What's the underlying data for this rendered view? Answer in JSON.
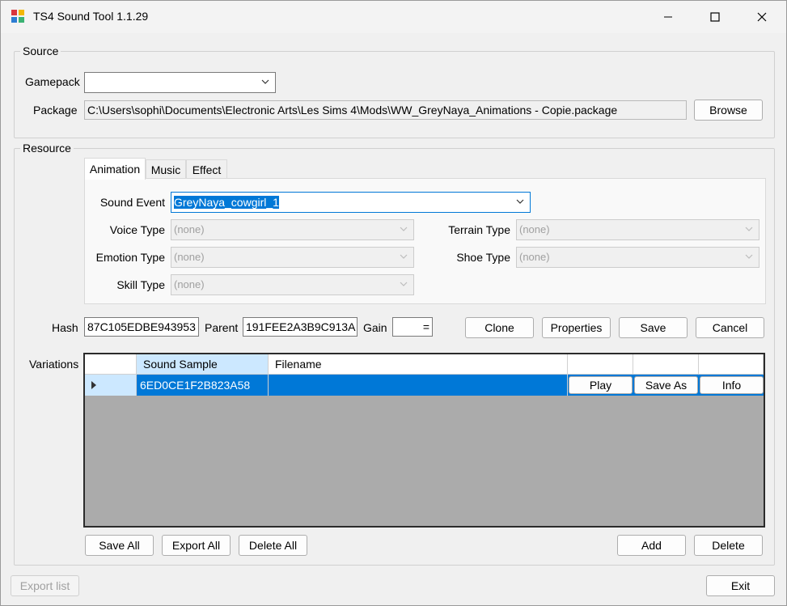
{
  "window": {
    "title": "TS4 Sound Tool 1.1.29",
    "minimize_icon": "minimize-icon",
    "maximize_icon": "maximize-icon",
    "close_icon": "close-icon"
  },
  "source": {
    "group_label": "Source",
    "gamepack_label": "Gamepack",
    "gamepack_value": "",
    "package_label": "Package",
    "package_value": "C:\\Users\\sophi\\Documents\\Electronic Arts\\Les Sims 4\\Mods\\WW_GreyNaya_Animations - Copie.package",
    "browse_label": "Browse"
  },
  "resource": {
    "group_label": "Resource",
    "tabs": [
      {
        "label": "Animation"
      },
      {
        "label": "Music"
      },
      {
        "label": "Effect"
      }
    ],
    "sound_event_label": "Sound Event",
    "sound_event_value": "GreyNaya_cowgirl_1",
    "voice_type_label": "Voice Type",
    "voice_type_value": "(none)",
    "emotion_type_label": "Emotion Type",
    "emotion_type_value": "(none)",
    "skill_type_label": "Skill Type",
    "skill_type_value": "(none)",
    "terrain_type_label": "Terrain Type",
    "terrain_type_value": "(none)",
    "shoe_type_label": "Shoe Type",
    "shoe_type_value": "(none)",
    "hash_label": "Hash",
    "hash_value": "87C105EDBE943953",
    "parent_label": "Parent",
    "parent_value": "191FEE2A3B9C913A",
    "gain_label": "Gain",
    "gain_value": "=",
    "clone_label": "Clone",
    "properties_label": "Properties",
    "save_label": "Save",
    "cancel_label": "Cancel",
    "variations_label": "Variations",
    "grid": {
      "columns": [
        "Sound Sample",
        "Filename"
      ],
      "rows": [
        {
          "sound_sample": "6ED0CE1F2B823A58",
          "filename": "",
          "play": "Play",
          "save_as": "Save As",
          "info": "Info"
        }
      ]
    },
    "save_all_label": "Save All",
    "export_all_label": "Export All",
    "delete_all_label": "Delete All",
    "add_label": "Add",
    "delete_label": "Delete"
  },
  "footer": {
    "export_list_label": "Export list",
    "exit_label": "Exit"
  }
}
